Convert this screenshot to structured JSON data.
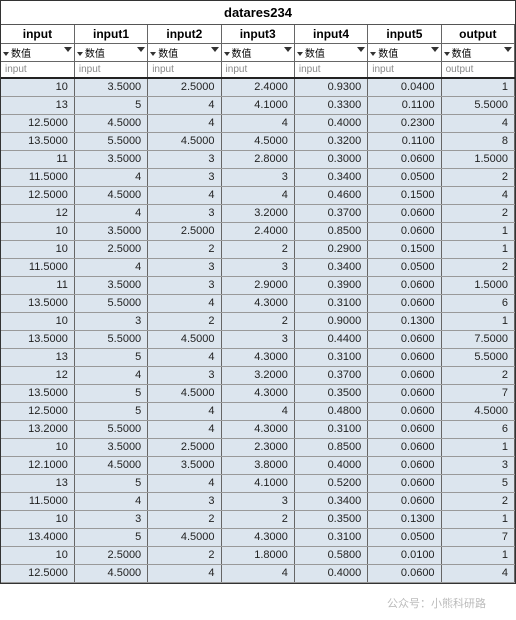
{
  "title": "datares234",
  "columns": [
    {
      "name": "input",
      "sub": "数值",
      "type": "input"
    },
    {
      "name": "input1",
      "sub": "数值",
      "type": "input"
    },
    {
      "name": "input2",
      "sub": "数值",
      "type": "input"
    },
    {
      "name": "input3",
      "sub": "数值",
      "type": "input"
    },
    {
      "name": "input4",
      "sub": "数值",
      "type": "input"
    },
    {
      "name": "input5",
      "sub": "数值",
      "type": "input"
    },
    {
      "name": "output",
      "sub": "数值",
      "type": "output"
    }
  ],
  "rows": [
    [
      "10",
      "3.5000",
      "2.5000",
      "2.4000",
      "0.9300",
      "0.0400",
      "1"
    ],
    [
      "13",
      "5",
      "4",
      "4.1000",
      "0.3300",
      "0.1100",
      "5.5000"
    ],
    [
      "12.5000",
      "4.5000",
      "4",
      "4",
      "0.4000",
      "0.2300",
      "4"
    ],
    [
      "13.5000",
      "5.5000",
      "4.5000",
      "4.5000",
      "0.3200",
      "0.1100",
      "8"
    ],
    [
      "11",
      "3.5000",
      "3",
      "2.8000",
      "0.3000",
      "0.0600",
      "1.5000"
    ],
    [
      "11.5000",
      "4",
      "3",
      "3",
      "0.3400",
      "0.0500",
      "2"
    ],
    [
      "12.5000",
      "4.5000",
      "4",
      "4",
      "0.4600",
      "0.1500",
      "4"
    ],
    [
      "12",
      "4",
      "3",
      "3.2000",
      "0.3700",
      "0.0600",
      "2"
    ],
    [
      "10",
      "3.5000",
      "2.5000",
      "2.4000",
      "0.8500",
      "0.0600",
      "1"
    ],
    [
      "10",
      "2.5000",
      "2",
      "2",
      "0.2900",
      "0.1500",
      "1"
    ],
    [
      "11.5000",
      "4",
      "3",
      "3",
      "0.3400",
      "0.0500",
      "2"
    ],
    [
      "11",
      "3.5000",
      "3",
      "2.9000",
      "0.3900",
      "0.0600",
      "1.5000"
    ],
    [
      "13.5000",
      "5.5000",
      "4",
      "4.3000",
      "0.3100",
      "0.0600",
      "6"
    ],
    [
      "10",
      "3",
      "2",
      "2",
      "0.9000",
      "0.1300",
      "1"
    ],
    [
      "13.5000",
      "5.5000",
      "4.5000",
      "3",
      "0.4400",
      "0.0600",
      "7.5000"
    ],
    [
      "13",
      "5",
      "4",
      "4.3000",
      "0.3100",
      "0.0600",
      "5.5000"
    ],
    [
      "12",
      "4",
      "3",
      "3.2000",
      "0.3700",
      "0.0600",
      "2"
    ],
    [
      "13.5000",
      "5",
      "4.5000",
      "4.3000",
      "0.3500",
      "0.0600",
      "7"
    ],
    [
      "12.5000",
      "5",
      "4",
      "4",
      "0.4800",
      "0.0600",
      "4.5000"
    ],
    [
      "13.2000",
      "5.5000",
      "4",
      "4.3000",
      "0.3100",
      "0.0600",
      "6"
    ],
    [
      "10",
      "3.5000",
      "2.5000",
      "2.3000",
      "0.8500",
      "0.0600",
      "1"
    ],
    [
      "12.1000",
      "4.5000",
      "3.5000",
      "3.8000",
      "0.4000",
      "0.0600",
      "3"
    ],
    [
      "13",
      "5",
      "4",
      "4.1000",
      "0.5200",
      "0.0600",
      "5"
    ],
    [
      "11.5000",
      "4",
      "3",
      "3",
      "0.3400",
      "0.0600",
      "2"
    ],
    [
      "10",
      "3",
      "2",
      "2",
      "0.3500",
      "0.1300",
      "1"
    ],
    [
      "13.4000",
      "5",
      "4.5000",
      "4.3000",
      "0.3100",
      "0.0500",
      "7"
    ],
    [
      "10",
      "2.5000",
      "2",
      "1.8000",
      "0.5800",
      "0.0100",
      "1"
    ],
    [
      "12.5000",
      "4.5000",
      "4",
      "4",
      "0.4000",
      "0.0600",
      "4"
    ]
  ],
  "watermark": "公众号：小熊科研路"
}
